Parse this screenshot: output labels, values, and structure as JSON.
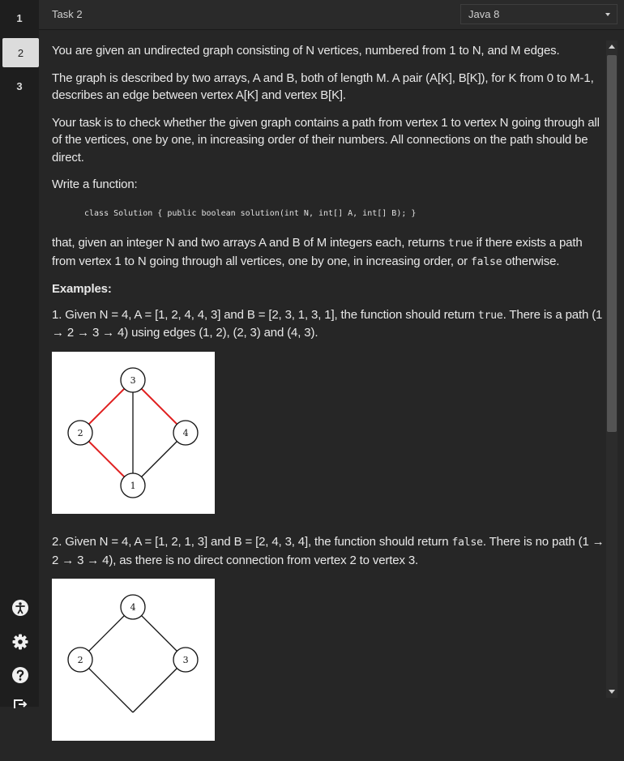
{
  "nav": {
    "tasks": [
      "1",
      "2",
      "3"
    ],
    "active_task": "2",
    "icons": [
      "accessibility-icon",
      "gear-icon",
      "help-icon",
      "exit-icon"
    ]
  },
  "topbar": {
    "task_title": "Task 2",
    "language": "Java 8"
  },
  "task": {
    "p1": "You are given an undirected graph consisting of N vertices, numbered from 1 to N, and M edges.",
    "p2": "The graph is described by two arrays, A and B, both of length M. A pair (A[K], B[K]), for K from 0 to M-1, describes an edge between vertex A[K] and vertex B[K].",
    "p3": "Your task is to check whether the given graph contains a path from vertex 1 to vertex N going through all of the vertices, one by one, in increasing order of their numbers. All connections on the path should be direct.",
    "p4": "Write a function:",
    "code": "class Solution { public boolean solution(int N, int[] A, int[] B); }",
    "p5_a": "that, given an integer N and two arrays A and B of M integers each, returns ",
    "p5_true": "true",
    "p5_b": " if there exists a path from vertex 1 to N going through all vertices, one by one, in increasing order, or ",
    "p5_false": "false",
    "p5_c": " otherwise.",
    "examples_heading": "Examples:",
    "ex1_a": "1. Given N = 4, A = [1, 2, 4, 4, 3] and B = [2, 3, 1, 3, 1], the function should return ",
    "ex1_ret": "true",
    "ex1_b": ". There is a path (1 → 2 → 3 → 4) using edges (1, 2), (2, 3) and (4, 3).",
    "ex2_a": "2. Given N = 4, A = [1, 2, 1, 3] and B = [2, 4, 3, 4], the function should return ",
    "ex2_ret": "false",
    "ex2_b": ". There is no path (1 → 2 → 3 → 4), as there is no direct connection from vertex 2 to vertex 3."
  },
  "graph1": {
    "nodes": [
      "3",
      "2",
      "4",
      "1"
    ],
    "edge_colors": {
      "path": "#e02020",
      "other": "#111111"
    }
  },
  "graph2": {
    "nodes": [
      "4",
      "2",
      "3"
    ]
  }
}
